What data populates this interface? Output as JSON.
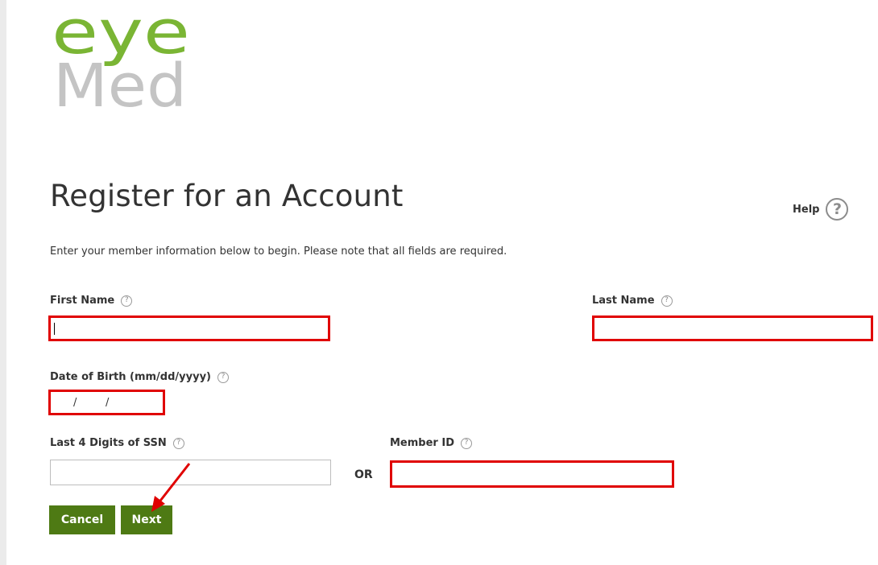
{
  "logo": {
    "alt": "EyeMed",
    "line1": "eye",
    "line2": "Med",
    "green": "#7ab534",
    "grey": "#c4c4c4"
  },
  "header": {
    "title": "Register for an Account",
    "help_label": "Help",
    "help_icon": "question-circle-icon"
  },
  "intro_text": "Enter your member information below to begin. Please note that all fields are required.",
  "form": {
    "first_name": {
      "label": "First Name",
      "value": ""
    },
    "last_name": {
      "label": "Last Name",
      "value": ""
    },
    "dob": {
      "label": "Date of Birth (mm/dd/yyyy)",
      "separator": "/"
    },
    "ssn": {
      "label": "Last 4 Digits of SSN",
      "value": ""
    },
    "or_label": "OR",
    "member_id": {
      "label": "Member ID",
      "value": ""
    }
  },
  "info_icon_glyph": "?",
  "help_icon_glyph": "?",
  "buttons": {
    "cancel": "Cancel",
    "next": "Next"
  },
  "colors": {
    "button_green": "#4e7a14",
    "highlight_red": "#e00000",
    "annotation_arrow": "#e00000"
  }
}
